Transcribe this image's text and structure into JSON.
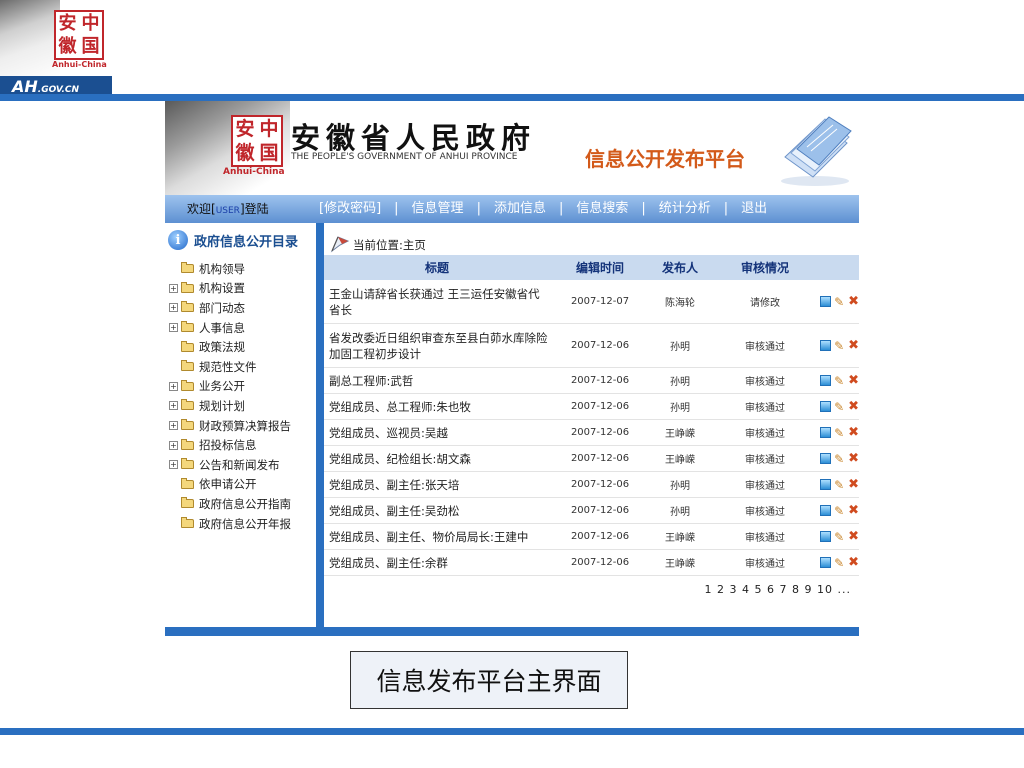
{
  "corner_logo": {
    "seal": [
      "安",
      "中",
      "徽",
      "国"
    ],
    "anhui_china": "Anhui-China",
    "domain_main": "AH",
    "domain_suffix": ".GOV.CN"
  },
  "header": {
    "seal": [
      "安",
      "中",
      "徽",
      "国"
    ],
    "anhui_china": "Anhui-China",
    "gov_name_cn": "安徽省人民政府",
    "gov_name_en": "THE PEOPLE'S GOVERNMENT OF ANHUI PROVINCE",
    "platform_title": "信息公开发布平台"
  },
  "navbar": {
    "welcome_prefix": "欢迎[",
    "user": "USER",
    "welcome_suffix": "]登陆",
    "menu": [
      "[修改密码]",
      "信息管理",
      "添加信息",
      "信息搜索",
      "统计分析",
      "退出"
    ]
  },
  "sidebar": {
    "title": "政府信息公开目录",
    "items": [
      {
        "label": "机构领导",
        "expandable": false
      },
      {
        "label": "机构设置",
        "expandable": true
      },
      {
        "label": "部门动态",
        "expandable": true
      },
      {
        "label": "人事信息",
        "expandable": true
      },
      {
        "label": "政策法规",
        "expandable": false
      },
      {
        "label": "规范性文件",
        "expandable": false
      },
      {
        "label": "业务公开",
        "expandable": true
      },
      {
        "label": "规划计划",
        "expandable": true
      },
      {
        "label": "财政预算决算报告",
        "expandable": true
      },
      {
        "label": "招投标信息",
        "expandable": true
      },
      {
        "label": "公告和新闻发布",
        "expandable": true
      },
      {
        "label": "依申请公开",
        "expandable": false
      },
      {
        "label": "政府信息公开指南",
        "expandable": false
      },
      {
        "label": "政府信息公开年报",
        "expandable": false
      }
    ]
  },
  "main": {
    "breadcrumb": "当前位置:主页",
    "columns": [
      "标题",
      "编辑时间",
      "发布人",
      "审核情况"
    ],
    "rows": [
      {
        "title": "王金山请辞省长获通过 王三运任安徽省代省长",
        "date": "2007-12-07",
        "publisher": "陈海轮",
        "status": "请修改"
      },
      {
        "title": "省发改委近日组织审查东至县白茆水库除险加固工程初步设计",
        "date": "2007-12-06",
        "publisher": "孙明",
        "status": "审核通过"
      },
      {
        "title": "副总工程师:武哲",
        "date": "2007-12-06",
        "publisher": "孙明",
        "status": "审核通过"
      },
      {
        "title": "党组成员、总工程师:朱也牧",
        "date": "2007-12-06",
        "publisher": "孙明",
        "status": "审核通过"
      },
      {
        "title": "党组成员、巡视员:吴越",
        "date": "2007-12-06",
        "publisher": "王峥嵘",
        "status": "审核通过"
      },
      {
        "title": "党组成员、纪检组长:胡文森",
        "date": "2007-12-06",
        "publisher": "王峥嵘",
        "status": "审核通过"
      },
      {
        "title": "党组成员、副主任:张天培",
        "date": "2007-12-06",
        "publisher": "孙明",
        "status": "审核通过"
      },
      {
        "title": "党组成员、副主任:吴劲松",
        "date": "2007-12-06",
        "publisher": "孙明",
        "status": "审核通过"
      },
      {
        "title": "党组成员、副主任、物价局局长:王建中",
        "date": "2007-12-06",
        "publisher": "王峥嵘",
        "status": "审核通过"
      },
      {
        "title": "党组成员、副主任:余群",
        "date": "2007-12-06",
        "publisher": "王峥嵘",
        "status": "审核通过"
      }
    ],
    "pager": "1 2 3 4 5 6 7 8 9 10 ..."
  },
  "caption": "信息发布平台主界面",
  "icons": {
    "view": "view-icon",
    "edit": "edit-pencil-icon",
    "delete": "delete-x-icon",
    "folder": "folder-icon",
    "info": "info-icon"
  },
  "colors": {
    "accent_blue": "#2a6fc0",
    "seal_red": "#c0262b",
    "title_orange": "#d35a1a"
  }
}
